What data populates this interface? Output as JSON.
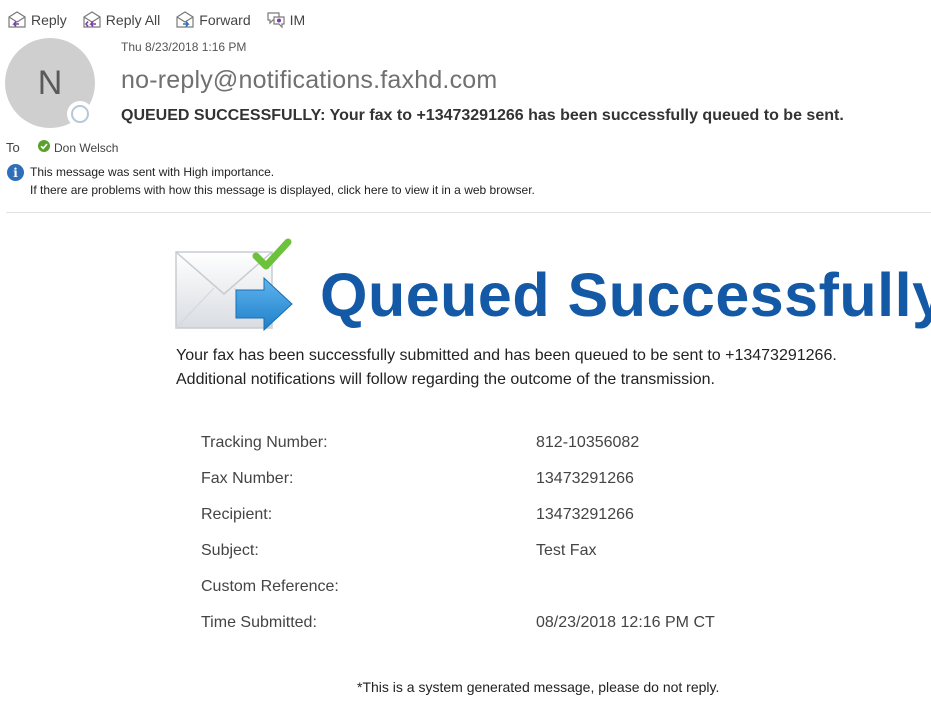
{
  "toolbar": {
    "reply_label": "Reply",
    "reply_all_label": "Reply All",
    "forward_label": "Forward",
    "im_label": "IM"
  },
  "message": {
    "avatar_initial": "N",
    "date": "Thu 8/23/2018 1:16 PM",
    "sender": "no-reply@notifications.faxhd.com",
    "subject": "QUEUED SUCCESSFULLY: Your fax to +13473291266 has been successfully queued to be sent.",
    "to_label": "To",
    "recipient": "Don Welsch",
    "info_line1": "This message was sent with High importance.",
    "info_line2": "If there are problems with how this message is displayed, click here to view it in a web browser."
  },
  "body": {
    "hero_title": "Queued Successfully",
    "intro_line1": "Your fax has been successfully submitted and has been queued to be sent to +13473291266.",
    "intro_line2": "Additional notifications will follow regarding the outcome of the transmission.",
    "details": [
      {
        "label": "Tracking Number:",
        "value": "812-10356082"
      },
      {
        "label": "Fax Number:",
        "value": "13473291266"
      },
      {
        "label": "Recipient:",
        "value": "13473291266"
      },
      {
        "label": "Subject:",
        "value": "Test Fax"
      },
      {
        "label": "Custom Reference:",
        "value": ""
      },
      {
        "label": "Time Submitted:",
        "value": "08/23/2018 12:16 PM CT"
      }
    ],
    "footer": "*This is a system generated message, please do not reply."
  },
  "colors": {
    "accent_blue": "#1359a6",
    "presence_green": "#5aa02c",
    "info_blue": "#2f6fb8"
  },
  "icons": [
    "reply-icon",
    "reply-all-icon",
    "forward-icon",
    "im-icon",
    "presence-icon",
    "available-check-icon",
    "info-icon",
    "envelope-check-arrow-icon"
  ]
}
